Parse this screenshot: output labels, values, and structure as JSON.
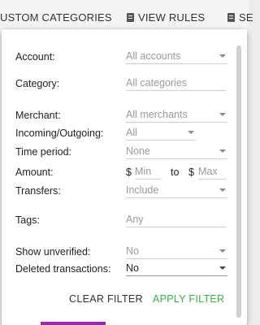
{
  "toolbar": {
    "custom_categories": "USTOM CATEGORIES",
    "view_rules": "VIEW RULES",
    "se": "SE"
  },
  "filter": {
    "account": {
      "label": "Account:",
      "value": "All accounts"
    },
    "category": {
      "label": "Category:",
      "value": "All categories"
    },
    "merchant": {
      "label": "Merchant:",
      "value": "All merchants"
    },
    "incoming": {
      "label": "Incoming/Outgoing:",
      "value": "All"
    },
    "time_period": {
      "label": "Time period:",
      "value": "None"
    },
    "amount": {
      "label": "Amount:",
      "currency1": "$",
      "min_placeholder": "Min",
      "to": "to",
      "currency2": "$",
      "max_placeholder": "Max"
    },
    "transfers": {
      "label": "Transfers:",
      "value": "Include"
    },
    "tags": {
      "label": "Tags:",
      "value": "Any"
    },
    "show_unverified": {
      "label": "Show unverified:",
      "value": "No"
    },
    "deleted_transactions": {
      "label": "Deleted transactions:",
      "value": "No"
    }
  },
  "actions": {
    "clear": "CLEAR FILTER",
    "apply": "APPLY FILTER"
  },
  "colors": {
    "apply": "#3db04a"
  }
}
